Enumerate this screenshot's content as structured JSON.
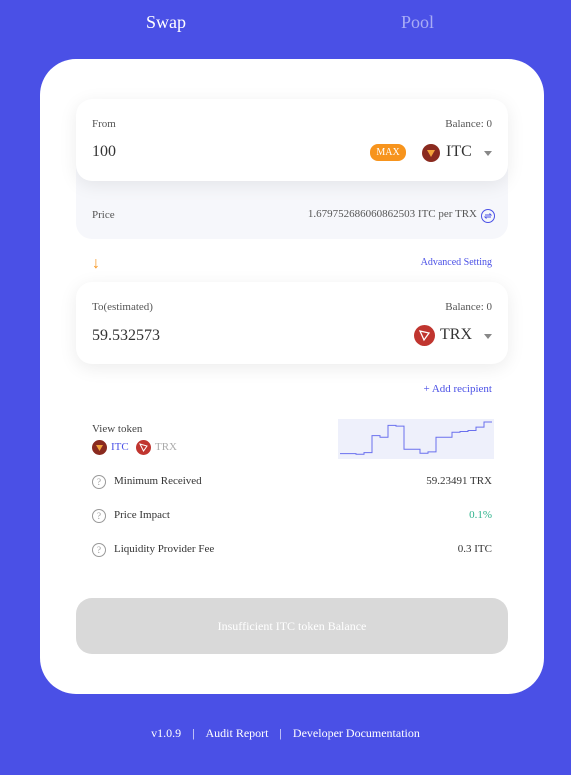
{
  "tabs": {
    "swap": "Swap",
    "pool": "Pool"
  },
  "from": {
    "label": "From",
    "balance": "Balance: 0",
    "amount": "100",
    "max": "MAX",
    "token": "ITC"
  },
  "price": {
    "label": "Price",
    "value": "1.679752686060862503 ITC per TRX"
  },
  "advanced_setting": "Advanced Setting",
  "to": {
    "label": "To(estimated)",
    "balance": "Balance: 0",
    "amount": "59.532573",
    "token": "TRX"
  },
  "add_recipient": "+ Add recipient",
  "view_token": {
    "label": "View token",
    "itc": "ITC",
    "trx": "TRX",
    "sparkline": [
      0.93,
      0.93,
      0.95,
      0.9,
      0.4,
      0.45,
      0.1,
      0.12,
      0.8,
      0.8,
      0.92,
      0.88,
      0.45,
      0.45,
      0.3,
      0.28,
      0.25,
      0.15,
      0.0,
      0.0
    ]
  },
  "info": {
    "min_received_label": "Minimum Received",
    "min_received_value": "59.23491 TRX",
    "price_impact_label": "Price Impact",
    "price_impact_value": "0.1%",
    "lp_fee_label": "Liquidity Provider Fee",
    "lp_fee_value": "0.3 ITC"
  },
  "submit": "Insufficient ITC token Balance",
  "footer": {
    "version": "v1.0.9",
    "sep": "|",
    "audit": "Audit Report",
    "docs": "Developer Documentation"
  },
  "colors": {
    "accent": "#4a50e6",
    "orange": "#f7941d",
    "green": "#2eb38c"
  }
}
